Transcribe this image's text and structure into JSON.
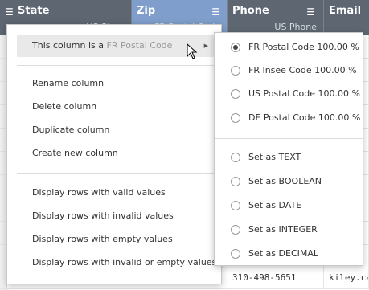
{
  "grid": {
    "columns": [
      {
        "key": "state",
        "title": "State",
        "type": "US State"
      },
      {
        "key": "zip",
        "title": "Zip",
        "type": "FR Postal Code"
      },
      {
        "key": "phone",
        "title": "Phone",
        "type": "US Phone"
      },
      {
        "key": "email",
        "title": "Email",
        "type": ""
      }
    ],
    "visible_rows": [
      {
        "phone": "310-498-5651",
        "email": "kiley.cal"
      }
    ]
  },
  "context_menu": {
    "semantic_type_prefix": "This column is a ",
    "semantic_type_value": "FR Postal Code",
    "actions": [
      "Rename column",
      "Delete column",
      "Duplicate column",
      "Create new column"
    ],
    "filters": [
      "Display rows with valid values",
      "Display rows with invalid values",
      "Display rows with empty values",
      "Display rows with invalid or empty values"
    ]
  },
  "submenu": {
    "semantic_options": [
      {
        "label": "FR Postal Code 100.00 %",
        "checked": true
      },
      {
        "label": "FR Insee Code 100.00 %",
        "checked": false
      },
      {
        "label": "US Postal Code 100.00 %",
        "checked": false
      },
      {
        "label": "DE Postal Code 100.00 %",
        "checked": false
      }
    ],
    "type_options": [
      {
        "label": "Set as TEXT",
        "checked": false
      },
      {
        "label": "Set as BOOLEAN",
        "checked": false
      },
      {
        "label": "Set as DATE",
        "checked": false
      },
      {
        "label": "Set as INTEGER",
        "checked": false
      },
      {
        "label": "Set as DECIMAL",
        "checked": false
      }
    ]
  },
  "colors": {
    "header_bg": "#5d6671",
    "selected_column_bg": "#7f9ecb",
    "menu_highlight": "#e9e9e9"
  },
  "icons": [
    "menu-icon",
    "chevron-right-icon",
    "radio-icon",
    "mouse-cursor-icon"
  ]
}
